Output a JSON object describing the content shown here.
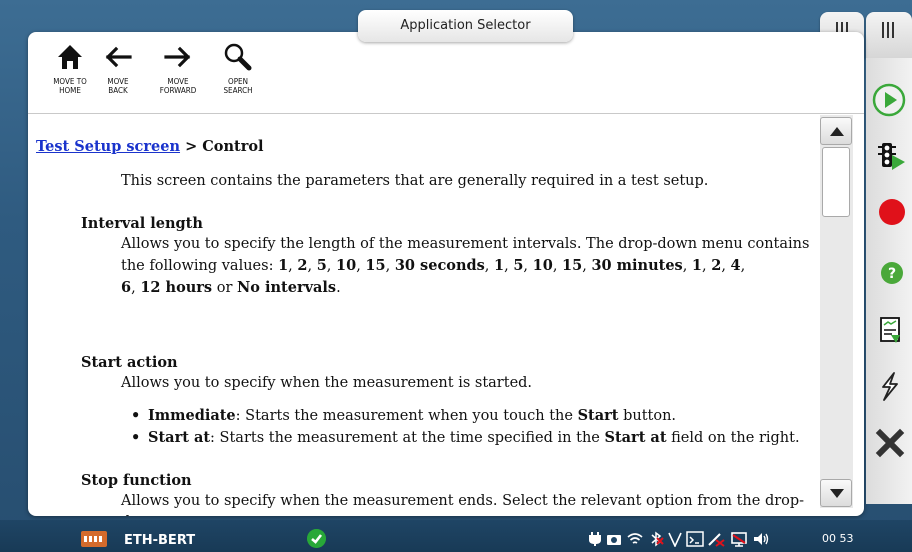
{
  "app_selector": {
    "label": "Application Selector"
  },
  "toolbar": {
    "home_label": "MOVE TO\nHOME",
    "back_label": "MOVE\nBACK",
    "forward_label": "MOVE\nFORWARD",
    "search_label": "OPEN\nSEARCH"
  },
  "content": {
    "breadcrumb_link": "Test Setup screen",
    "breadcrumb_rest": " > Control",
    "intro": "This screen contains the parameters that are generally required in a test setup.",
    "interval": {
      "heading": "Interval length",
      "text_a": "Allows you to specify the length of the measurement intervals. The drop-down menu contains the following values: ",
      "v1": "1",
      "sep1": ", ",
      "v2": "2",
      "sep2": ", ",
      "v3": "5",
      "sep3": ", ",
      "v4": "10",
      "sep4": ", ",
      "v5": "15",
      "sep5": ", ",
      "v6": "30 seconds",
      "sep6": ", ",
      "m1": "1",
      "msep1": ", ",
      "m2": "5",
      "msep2": ", ",
      "m3": "10",
      "msep3": ", ",
      "m4": "15",
      "msep4": ", ",
      "m5": "30 minutes",
      "msep5": ", ",
      "h1": "1",
      "hsep1": ", ",
      "h2": "2",
      "hsep2": ", ",
      "h3": "4",
      "hsep3": ",",
      "h4": "6",
      "hsep4": ", ",
      "h5": "12 hours",
      "or": " or ",
      "none": "No intervals",
      "end": "."
    },
    "start": {
      "heading": "Start action",
      "text": "Allows you to specify when the measurement is started.",
      "b1_term": "Immediate",
      "b1_text": ": Starts the measurement when you touch the ",
      "b1_bold": "Start",
      "b1_end": " button.",
      "b2_term": "Start at",
      "b2_text": ": Starts the measurement at the time specified in the ",
      "b2_bold": "Start at",
      "b2_end": " field on the right."
    },
    "stop": {
      "heading": "Stop function",
      "text": "Allows you to specify when the measurement ends. Select the relevant option from the drop-down menu:"
    }
  },
  "status": {
    "app_name": "ETH-BERT",
    "time": "00 53"
  },
  "colors": {
    "link": "#1a33cc",
    "record": "#e0111a",
    "play": "#3aa83a",
    "help": "#4aa83a"
  },
  "icons": [
    "home-icon",
    "back-arrow-icon",
    "forward-arrow-icon",
    "search-icon",
    "play-icon",
    "traffic-light-icon",
    "record-icon",
    "help-icon",
    "report-icon",
    "lightning-icon",
    "close-icon"
  ]
}
